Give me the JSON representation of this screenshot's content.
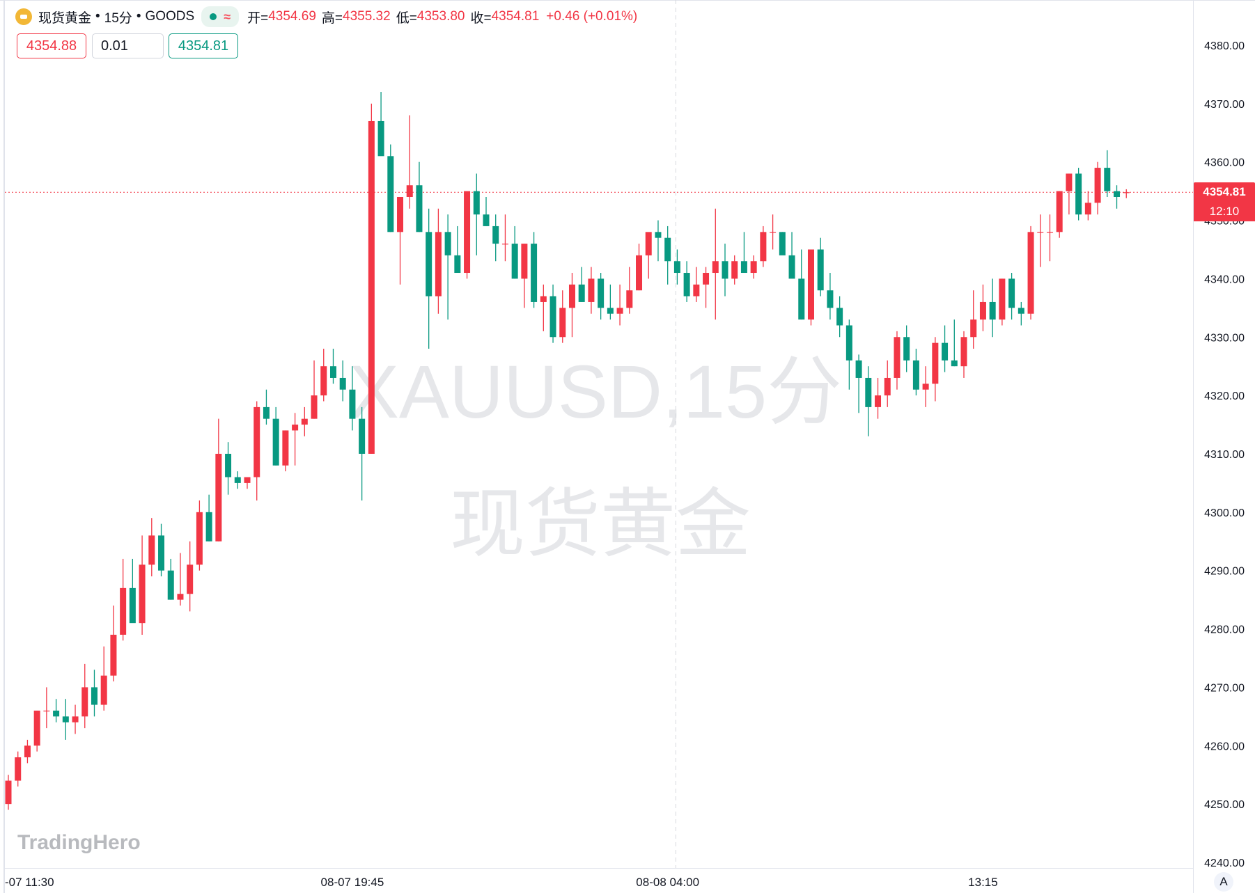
{
  "header": {
    "symbol_name": "现货黄金",
    "interval": "15分",
    "source": "GOODS",
    "open_label": "开=",
    "open": "4354.69",
    "high_label": "高=",
    "high": "4355.32",
    "low_label": "低=",
    "low": "4353.80",
    "close_label": "收=",
    "close": "4354.81",
    "change": "+0.46 (+0.01%)"
  },
  "trade": {
    "sell_price": "4354.88",
    "quantity": "0.01",
    "buy_price": "4354.81"
  },
  "price_tag": {
    "price": "4354.81",
    "countdown": "12:10"
  },
  "watermark": {
    "line1": "XAUUSD,15分",
    "line2": "现货黄金"
  },
  "logo": "TradingHero",
  "auto_button": "A",
  "colors": {
    "up": "#f23645",
    "down": "#089981",
    "grid": "#e0e3eb",
    "watermark": "#e6e7ea"
  },
  "chart_data": {
    "type": "candlestick",
    "ylim": [
      4240,
      4380
    ],
    "y_ticks": [
      "4380.00",
      "4370.00",
      "4360.00",
      "4350.00",
      "4340.00",
      "4330.00",
      "4320.00",
      "4310.00",
      "4300.00",
      "4290.00",
      "4280.00",
      "4270.00",
      "4260.00",
      "4250.00",
      "4240.00"
    ],
    "x_labels": [
      {
        "index": 0,
        "label": "-07 11:30"
      },
      {
        "index": 36,
        "label": "08-07 19:45"
      },
      {
        "index": 69,
        "label": "08-08 04:00"
      },
      {
        "index": 102,
        "label": "13:15"
      }
    ],
    "vertical_marker_index": 70,
    "current_price": 4354.81,
    "candles": [
      [
        4250,
        4255,
        4249,
        4254
      ],
      [
        4254,
        4259,
        4253,
        4258
      ],
      [
        4258,
        4261,
        4257,
        4260
      ],
      [
        4260,
        4266,
        4259,
        4266
      ],
      [
        4266,
        4270,
        4263,
        4266
      ],
      [
        4266,
        4268,
        4264,
        4265
      ],
      [
        4265,
        4268,
        4261,
        4264
      ],
      [
        4264,
        4267,
        4262,
        4265
      ],
      [
        4265,
        4274,
        4263,
        4270
      ],
      [
        4270,
        4273,
        4265,
        4267
      ],
      [
        4267,
        4277,
        4266,
        4272
      ],
      [
        4272,
        4284,
        4271,
        4279
      ],
      [
        4279,
        4292,
        4278,
        4287
      ],
      [
        4287,
        4292,
        4282,
        4281
      ],
      [
        4281,
        4296,
        4279,
        4291
      ],
      [
        4291,
        4299,
        4289,
        4296
      ],
      [
        4296,
        4298,
        4289,
        4290
      ],
      [
        4290,
        4292,
        4285,
        4285
      ],
      [
        4285,
        4293,
        4284,
        4286
      ],
      [
        4286,
        4295,
        4283,
        4291
      ],
      [
        4291,
        4302,
        4290,
        4300
      ],
      [
        4300,
        4303,
        4295,
        4295
      ],
      [
        4295,
        4316,
        4295,
        4310
      ],
      [
        4310,
        4312,
        4303,
        4306
      ],
      [
        4306,
        4307,
        4304,
        4305
      ],
      [
        4305,
        4306,
        4304,
        4306
      ],
      [
        4306,
        4319,
        4302,
        4318
      ],
      [
        4318,
        4321,
        4315,
        4316
      ],
      [
        4316,
        4318,
        4308,
        4308
      ],
      [
        4308,
        4314,
        4307,
        4314
      ],
      [
        4314,
        4317,
        4308,
        4315
      ],
      [
        4315,
        4318,
        4313,
        4316
      ],
      [
        4316,
        4326,
        4316,
        4320
      ],
      [
        4320,
        4328,
        4319,
        4325
      ],
      [
        4325,
        4328,
        4322,
        4323
      ],
      [
        4323,
        4326,
        4319,
        4321
      ],
      [
        4321,
        4325,
        4314,
        4316
      ],
      [
        4316,
        4318,
        4302,
        4310
      ],
      [
        4310,
        4370,
        4310,
        4367
      ],
      [
        4367,
        4372,
        4364,
        4361
      ],
      [
        4361,
        4363,
        4348,
        4348
      ],
      [
        4348,
        4354,
        4339,
        4354
      ],
      [
        4354,
        4368,
        4352,
        4356
      ],
      [
        4356,
        4360,
        4348,
        4348
      ],
      [
        4348,
        4352,
        4328,
        4337
      ],
      [
        4337,
        4352,
        4334,
        4348
      ],
      [
        4348,
        4351,
        4333,
        4344
      ],
      [
        4344,
        4349,
        4341,
        4341
      ],
      [
        4341,
        4349,
        4340,
        4355
      ],
      [
        4355,
        4358,
        4344,
        4351
      ],
      [
        4351,
        4354,
        4349,
        4349
      ],
      [
        4349,
        4351,
        4343,
        4346
      ],
      [
        4346,
        4351,
        4343,
        4346
      ],
      [
        4346,
        4349,
        4340,
        4340
      ],
      [
        4340,
        4346,
        4335,
        4346
      ],
      [
        4346,
        4348,
        4335,
        4336
      ],
      [
        4336,
        4339,
        4331,
        4337
      ],
      [
        4337,
        4339,
        4329,
        4330
      ],
      [
        4330,
        4338,
        4329,
        4335
      ],
      [
        4335,
        4341,
        4330,
        4339
      ],
      [
        4339,
        4342,
        4336,
        4336
      ],
      [
        4336,
        4342,
        4334,
        4340
      ],
      [
        4340,
        4341,
        4333,
        4335
      ],
      [
        4335,
        4339,
        4333,
        4334
      ],
      [
        4334,
        4339,
        4332,
        4335
      ],
      [
        4335,
        4342,
        4334,
        4338
      ],
      [
        4338,
        4346,
        4338,
        4344
      ],
      [
        4344,
        4346,
        4340,
        4348
      ],
      [
        4348,
        4350,
        4343,
        4347
      ],
      [
        4347,
        4349,
        4339,
        4343
      ],
      [
        4343,
        4345,
        4339,
        4341
      ],
      [
        4341,
        4343,
        4336,
        4337
      ],
      [
        4337,
        4342,
        4336,
        4339
      ],
      [
        4339,
        4342,
        4335,
        4341
      ],
      [
        4341,
        4352,
        4333,
        4343
      ],
      [
        4343,
        4346,
        4337,
        4340
      ],
      [
        4340,
        4344,
        4339,
        4343
      ],
      [
        4343,
        4348,
        4341,
        4341
      ],
      [
        4341,
        4344,
        4340,
        4343
      ],
      [
        4343,
        4349,
        4342,
        4348
      ],
      [
        4348,
        4351,
        4345,
        4348
      ],
      [
        4348,
        4348,
        4346,
        4344
      ],
      [
        4344,
        4348,
        4343,
        4340
      ],
      [
        4340,
        4345,
        4333,
        4333
      ],
      [
        4333,
        4338,
        4332,
        4345
      ],
      [
        4345,
        4347,
        4337,
        4338
      ],
      [
        4338,
        4341,
        4333,
        4335
      ],
      [
        4335,
        4337,
        4330,
        4332
      ],
      [
        4332,
        4333,
        4321,
        4326
      ],
      [
        4326,
        4327,
        4317,
        4323
      ],
      [
        4323,
        4325,
        4313,
        4318
      ],
      [
        4318,
        4323,
        4316,
        4320
      ],
      [
        4320,
        4326,
        4318,
        4323
      ],
      [
        4323,
        4331,
        4321,
        4330
      ],
      [
        4330,
        4332,
        4324,
        4326
      ],
      [
        4326,
        4328,
        4320,
        4321
      ],
      [
        4321,
        4325,
        4318,
        4322
      ],
      [
        4322,
        4330,
        4319,
        4329
      ],
      [
        4329,
        4332,
        4324,
        4326
      ],
      [
        4326,
        4333,
        4325,
        4325
      ],
      [
        4325,
        4331,
        4323,
        4330
      ],
      [
        4330,
        4338,
        4328,
        4333
      ],
      [
        4333,
        4339,
        4331,
        4336
      ],
      [
        4336,
        4340,
        4330,
        4333
      ],
      [
        4333,
        4340,
        4332,
        4340
      ],
      [
        4340,
        4341,
        4333,
        4335
      ],
      [
        4335,
        4336,
        4332,
        4334
      ],
      [
        4334,
        4349,
        4333,
        4348
      ],
      [
        4348,
        4351,
        4342,
        4348
      ],
      [
        4348,
        4351,
        4343,
        4348
      ],
      [
        4348,
        4355,
        4347,
        4355
      ],
      [
        4355,
        4358,
        4351,
        4358
      ],
      [
        4358,
        4359,
        4350,
        4351
      ],
      [
        4351,
        4355,
        4350,
        4353
      ],
      [
        4353,
        4360,
        4351,
        4359
      ],
      [
        4359,
        4362,
        4354,
        4355
      ],
      [
        4355,
        4356,
        4352,
        4354
      ],
      [
        4354.69,
        4355.32,
        4353.8,
        4354.81
      ]
    ]
  }
}
